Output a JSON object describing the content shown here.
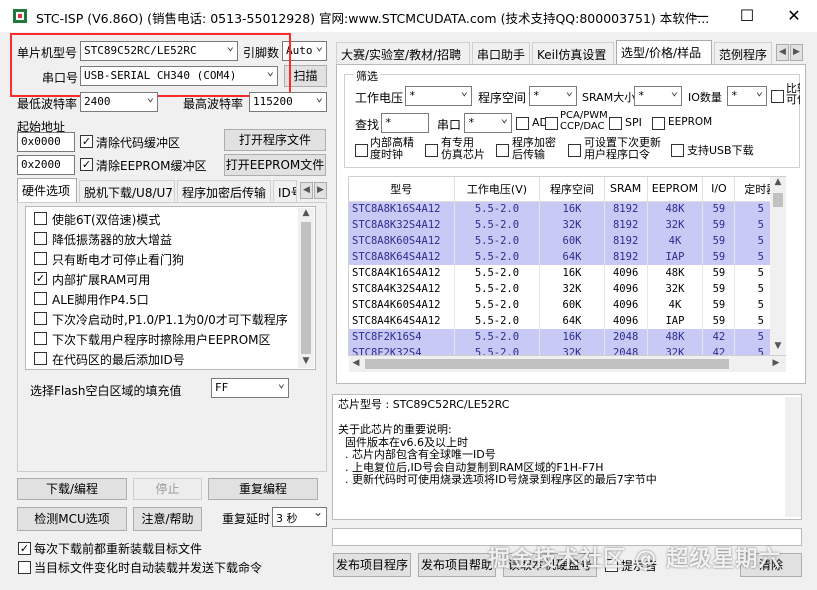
{
  "window": {
    "title": "STC-ISP (V6.86O) (销售电话: 0513-55012928) 官网:www.STCMCUDATA.com (技术支持QQ:800003751) 本软件...",
    "min": "—",
    "max": "☐",
    "close": "✕"
  },
  "left": {
    "mcu_label": "单片机型号",
    "mcu_value": "STC89C52RC/LE52RC",
    "pin_label": "引脚数",
    "pin_value": "Auto",
    "port_label": "串口号",
    "port_value": "USB-SERIAL CH340 (COM4)",
    "scan_button": "扫描",
    "min_baud_label": "最低波特率",
    "min_baud_value": "2400",
    "max_baud_label": "最高波特率",
    "max_baud_value": "115200",
    "start_addr_label": "起始地址",
    "addr1": "0x0000",
    "clear_code_label": "清除代码缓冲区",
    "open_program_button": "打开程序文件",
    "addr2": "0x2000",
    "clear_eeprom_label": "清除EEPROM缓冲区",
    "open_eeprom_button": "打开EEPROM文件",
    "tabs": [
      "硬件选项",
      "脱机下载/U8/U7",
      "程序加密后传输",
      "ID号"
    ],
    "options": [
      {
        "label": "使能6T(双倍速)模式",
        "checked": false
      },
      {
        "label": "降低振荡器的放大增益",
        "checked": false
      },
      {
        "label": "只有断电才可停止看门狗",
        "checked": false
      },
      {
        "label": "内部扩展RAM可用",
        "checked": true
      },
      {
        "label": "ALE脚用作P4.5口",
        "checked": false
      },
      {
        "label": "下次冷启动时,P1.0/P1.1为0/0才可下载程序",
        "checked": false
      },
      {
        "label": "下次下载用户程序时擦除用户EEPROM区",
        "checked": false
      },
      {
        "label": "在代码区的最后添加ID号",
        "checked": false
      }
    ],
    "fill_label": "选择Flash空白区域的填充值",
    "fill_value": "FF",
    "download_button": "下载/编程",
    "stop_button": "停止",
    "reprogram_button": "重复编程",
    "detect_button": "检测MCU选项",
    "help_button": "注意/帮助",
    "delay_label": "重复延时",
    "delay_value": "3 秒",
    "reload_label": "每次下载前都重新装载目标文件",
    "auto_send_label": "当目标文件变化时自动装载并发送下载命令"
  },
  "right": {
    "tabs": [
      "大赛/实验室/教材/招聘",
      "串口助手",
      "Keil仿真设置",
      "选型/价格/样品",
      "范例程序"
    ],
    "filter_title": "筛选",
    "voltage_label": "工作电压",
    "voltage_value": "*",
    "flash_label": "程序空间",
    "flash_value": "*",
    "sram_label": "SRAM大小",
    "sram_value": "*",
    "io_label": "IO数量",
    "io_value": "*",
    "comparator_label": "比较器(可当",
    "comparator_label2": "可作ADC检测",
    "search_label": "查找",
    "search_value": "*",
    "uart_label": "串口",
    "uart_value": "*",
    "adc_label": "ADC",
    "pca_label": "PCA/PWM",
    "pca_label2": "CCP/DAC",
    "spi_label": "SPI",
    "eeprom_label": "EEPROM",
    "hsclock_label": "内部高精",
    "hsclock_label2": "度时钟",
    "emu_label": "有专用",
    "emu_label2": "仿真芯片",
    "enc_label": "程序加密",
    "enc_label2": "后传输",
    "update_label": "可设置下次更新",
    "update_label2": "用户程序口令",
    "usb_label": "支持USB下载",
    "table_headers": [
      "型号",
      "工作电压(V)",
      "程序空间",
      "SRAM",
      "EEPROM",
      "I/O",
      "定时器"
    ],
    "table_rows": [
      {
        "hl": true,
        "cells": [
          "STC8A8K16S4A12",
          "5.5-2.0",
          "16K",
          "8192",
          "48K",
          "59",
          "5"
        ]
      },
      {
        "hl": true,
        "cells": [
          "STC8A8K32S4A12",
          "5.5-2.0",
          "32K",
          "8192",
          "32K",
          "59",
          "5"
        ]
      },
      {
        "hl": true,
        "cells": [
          "STC8A8K60S4A12",
          "5.5-2.0",
          "60K",
          "8192",
          "4K",
          "59",
          "5"
        ]
      },
      {
        "hl": true,
        "cells": [
          "STC8A8K64S4A12",
          "5.5-2.0",
          "64K",
          "8192",
          "IAP",
          "59",
          "5"
        ]
      },
      {
        "hl": false,
        "cells": [
          "STC8A4K16S4A12",
          "5.5-2.0",
          "16K",
          "4096",
          "48K",
          "59",
          "5"
        ]
      },
      {
        "hl": false,
        "cells": [
          "STC8A4K32S4A12",
          "5.5-2.0",
          "32K",
          "4096",
          "32K",
          "59",
          "5"
        ]
      },
      {
        "hl": false,
        "cells": [
          "STC8A4K60S4A12",
          "5.5-2.0",
          "60K",
          "4096",
          "4K",
          "59",
          "5"
        ]
      },
      {
        "hl": false,
        "cells": [
          "STC8A4K64S4A12",
          "5.5-2.0",
          "64K",
          "4096",
          "IAP",
          "59",
          "5"
        ]
      },
      {
        "hl": true,
        "cells": [
          "STC8F2K16S4",
          "5.5-2.0",
          "16K",
          "2048",
          "48K",
          "42",
          "5"
        ]
      },
      {
        "hl": true,
        "cells": [
          "STC8F2K32S4",
          "5.5-2.0",
          "32K",
          "2048",
          "32K",
          "42",
          "5"
        ]
      }
    ],
    "info_text": "芯片型号 : STC89C52RC/LE52RC\n\n关于此芯片的重要说明:\n  固件版本在v6.6及以上时\n  . 芯片内部包含有全球唯一ID号\n  . 上电复位后,ID号会自动复制到RAM区域的F1H-F7H\n  . 更新代码时可使用烧录选项将ID号烧录到程序区的最后7字节中",
    "publish_button": "发布项目程序",
    "publish_help_button": "发布项目帮助",
    "hidden_button3": "读取本机硬盘号",
    "hidden_button4": "提示音",
    "hidden_button5": "清除"
  },
  "watermark": "掘金技术社区 @ 超级星期六"
}
